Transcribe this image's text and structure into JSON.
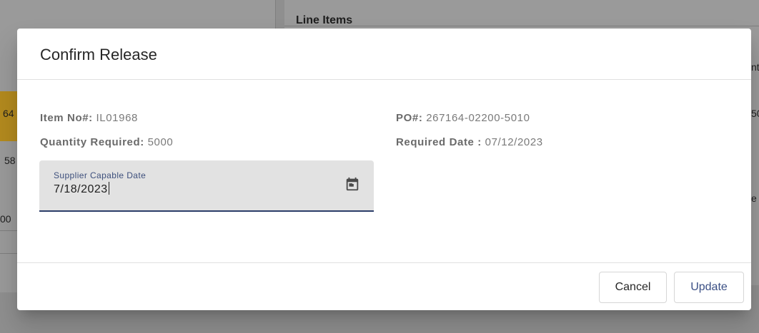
{
  "background": {
    "section_title": "Line Items",
    "fragments": [
      "64",
      "58",
      "00",
      "nt",
      "50",
      "e"
    ]
  },
  "dialog": {
    "title": "Confirm Release",
    "item_no": {
      "label": "Item No#:",
      "value": "IL01968"
    },
    "quantity": {
      "label": "Quantity Required:",
      "value": "5000"
    },
    "po": {
      "label": "PO#:",
      "value": "267164-02200-5010"
    },
    "required_date": {
      "label": "Required Date :",
      "value": "07/12/2023"
    },
    "supplier_date": {
      "label": "Supplier Capable Date",
      "value": "7/18/2023",
      "icon": "calendar-icon"
    },
    "buttons": {
      "cancel": "Cancel",
      "update": "Update"
    }
  },
  "colors": {
    "accent": "#2c3e69",
    "update_text": "#3b5085",
    "field_bg": "#e2e2e2"
  }
}
